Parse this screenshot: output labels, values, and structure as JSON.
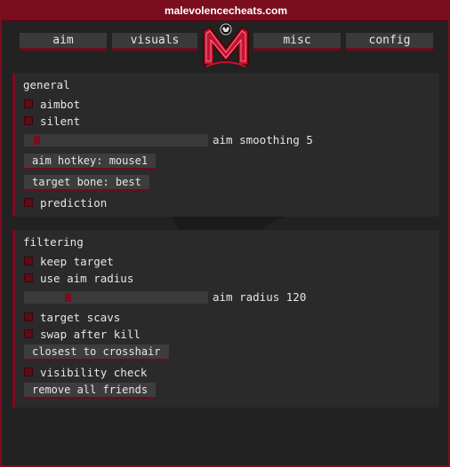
{
  "window": {
    "title": "malevolencecheats.com",
    "accent": "#7a0d1e"
  },
  "tabs": [
    {
      "label": "aim"
    },
    {
      "label": "visuals"
    },
    {
      "label": "misc"
    },
    {
      "label": "config"
    }
  ],
  "logo": {
    "icon": "malevolence-m-logo-icon"
  },
  "general": {
    "title": "general",
    "aimbot": "aimbot",
    "silent": "silent",
    "aim_smoothing_label": "aim smoothing 5",
    "aim_smoothing_value": 5,
    "aim_hotkey": "aim hotkey: mouse1",
    "target_bone": "target bone: best",
    "prediction": "prediction"
  },
  "filtering": {
    "title": "filtering",
    "keep_target": "keep target",
    "use_aim_radius": "use aim radius",
    "aim_radius_label": "aim radius 120",
    "aim_radius_value": 120,
    "target_scavs": "target scavs",
    "swap_after_kill": "swap after kill",
    "closest_to_crosshair": "closest to crosshair",
    "visibility_check": "visibility check",
    "remove_all_friends": "remove all friends"
  }
}
